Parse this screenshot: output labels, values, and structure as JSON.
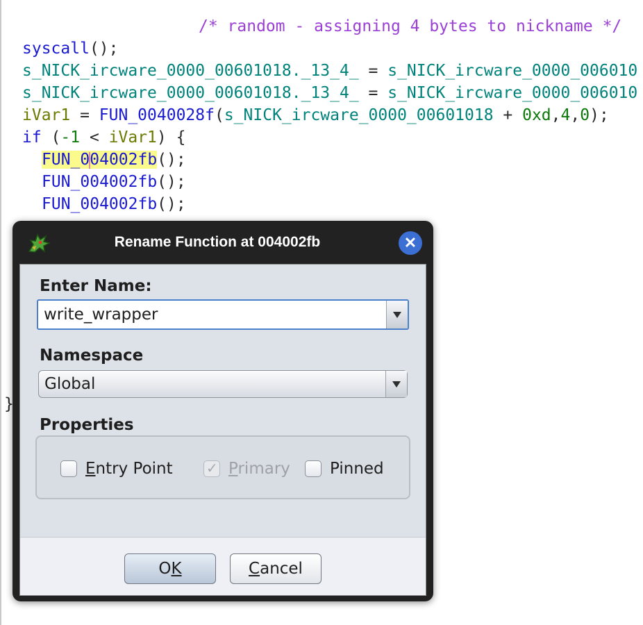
{
  "code": {
    "line1": {
      "comment": "/* random - assigning 4 bytes to nickname */"
    },
    "line2": {
      "call": "syscall",
      "tail": "();"
    },
    "line3": {
      "lhs": "s_NICK_ircware_0000_00601018",
      "field": "._13_4_",
      "op": " = ",
      "rhs": "s_NICK_ircware_0000_006010"
    },
    "line4": {
      "lhs": "s_NICK_ircware_0000_00601018",
      "field": "._13_4_",
      "op": " = ",
      "rhs": "s_NICK_ircware_0000_006010"
    },
    "line5": {
      "var": "iVar1",
      "op": " = ",
      "fn": "FUN_0040028f",
      "open": "(",
      "glob": "s_NICK_ircware_0000_00601018",
      "plus": " + ",
      "n1": "0xd",
      "c1": ",",
      "n2": "4",
      "c2": ",",
      "n3": "0",
      "close": ");"
    },
    "line6": {
      "kw": "if",
      "open": " (",
      "num": "-1",
      "lt": " < ",
      "var": "iVar1",
      "close": ") {"
    },
    "line7": {
      "fn_a": "FUN_0",
      "fn_b": "04002fb",
      "tail": "();"
    },
    "line8": {
      "fn": "FUN_004002fb",
      "tail": "();"
    },
    "line9": {
      "fn": "FUN_004002fb",
      "tail": "();"
    },
    "line10": {
      "text": "} "
    },
    "brace": "}"
  },
  "dialog": {
    "title": "Rename Function at 004002fb",
    "close_icon": "close-icon",
    "app_icon": "ghidra-dragon-icon",
    "name_label": "Enter Name:",
    "name_value": "write_wrapper",
    "namespace_label": "Namespace",
    "namespace_value": "Global",
    "properties_label": "Properties",
    "checkboxes": [
      {
        "mn": "E",
        "rest": "ntry Point",
        "checked": false,
        "enabled": true
      },
      {
        "mn": "P",
        "rest": "rimary",
        "checked": true,
        "enabled": false
      },
      {
        "mn": "",
        "rest": "Pinned",
        "checked": false,
        "enabled": true
      }
    ],
    "ok": {
      "a": "O",
      "mn": "K"
    },
    "cancel": {
      "mn": "C",
      "rest": "ancel"
    }
  },
  "colors": {
    "keyword": "#1a1ad0",
    "global": "#00837a",
    "comment": "#9b40d6",
    "number": "#0b7a0b",
    "variable": "#6b7a00",
    "highlight": "#fbfa8c",
    "close_button": "#3b6fd4"
  }
}
